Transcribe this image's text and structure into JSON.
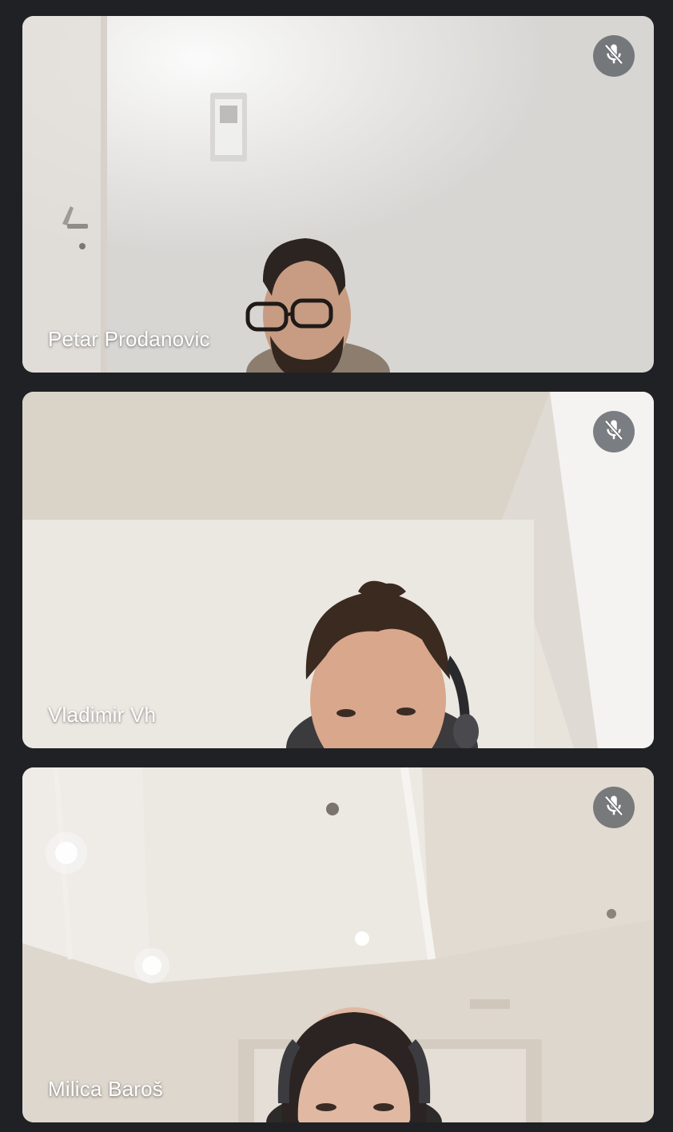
{
  "participants": [
    {
      "name": "Petar Prodanovic",
      "muted": true,
      "mute_icon": "mic-off-icon"
    },
    {
      "name": "Vladimir Vh",
      "muted": true,
      "mute_icon": "mic-off-icon"
    },
    {
      "name": "Milica Baroš",
      "muted": true,
      "mute_icon": "mic-off-icon"
    }
  ],
  "colors": {
    "background": "#202124",
    "mute_button": "#5f6368",
    "name_text": "#ffffff"
  }
}
